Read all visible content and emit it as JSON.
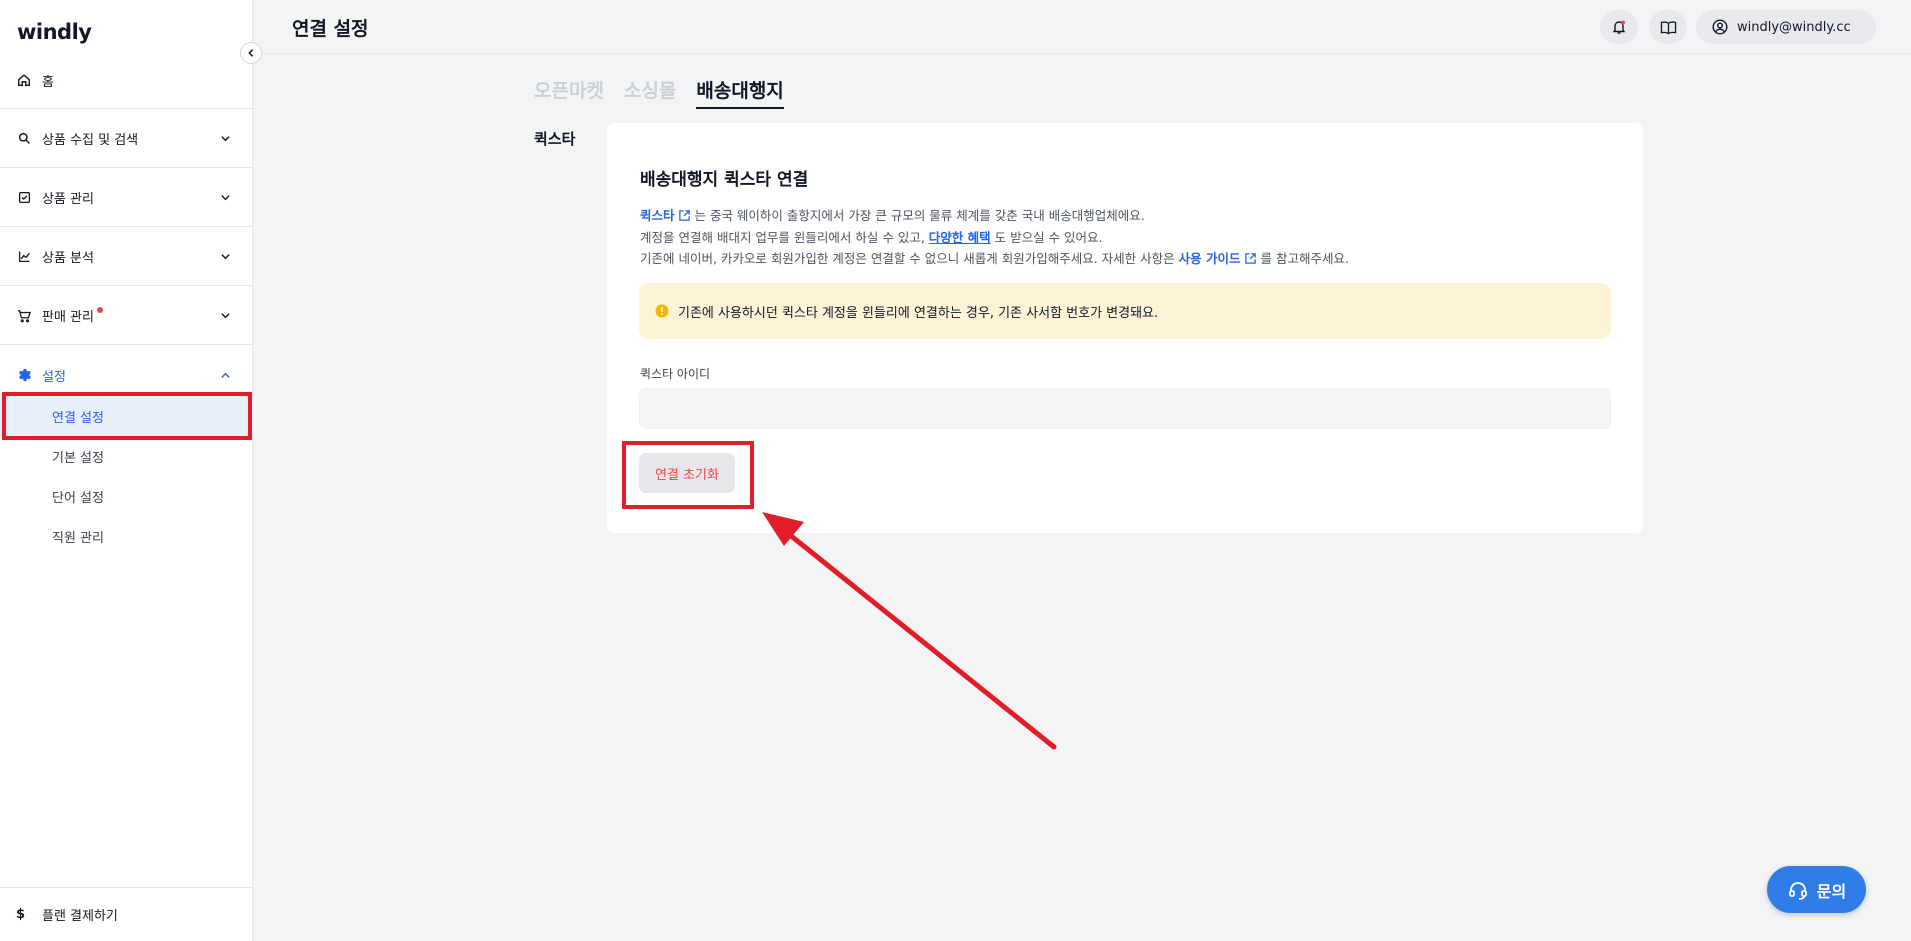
{
  "app": {
    "logo": "windly"
  },
  "header": {
    "title": "연결 설정",
    "user_email": "windly@windly.cc"
  },
  "sidebar": {
    "home": "홈",
    "items": [
      {
        "label": "상품 수집 및 검색"
      },
      {
        "label": "상품 관리"
      },
      {
        "label": "상품 분석"
      },
      {
        "label": "판매 관리"
      },
      {
        "label": "설정"
      }
    ],
    "sub_items": [
      {
        "label": "연결 설정"
      },
      {
        "label": "기본 설정"
      },
      {
        "label": "단어 설정"
      },
      {
        "label": "직원 관리"
      }
    ],
    "footer": "플랜 결제하기",
    "footer_icon": "$"
  },
  "tabs": [
    {
      "label": "오픈마켓"
    },
    {
      "label": "소싱몰"
    },
    {
      "label": "배송대행지"
    }
  ],
  "section": {
    "label": "퀵스타",
    "card_title": "배송대행지 퀵스타 연결",
    "line1_link": "퀵스타",
    "line1_text": " 는 중국 웨이하이 출항지에서 가장 큰 규모의 물류 체계를 갖춘 국내 배송대행업체에요.",
    "line2_text_a": "계정을 연결해 배대지 업무를 윈들리에서 하실 수 있고, ",
    "line2_link": "다양한 혜택",
    "line2_text_b": " 도 받으실 수 있어요.",
    "line3_text_a": "기존에 네이버, 카카오로 회원가입한 계정은 연결할 수 없으니 새롭게 회원가입해주세요. 자세한 사항은 ",
    "line3_link": "사용 가이드",
    "line3_text_b": " 를 참고해주세요.",
    "notice": "기존에 사용하시던 퀵스타 계정을 윈들리에 연결하는 경우, 기존 사서함 번호가 변경돼요.",
    "field_label": "퀵스타 아이디",
    "field_value": "",
    "reset_button": "연결 초기화"
  },
  "help": {
    "label": "문의"
  },
  "colors": {
    "accent": "#2563eb",
    "annotation": "#e11d2a",
    "notice_bg": "#fef3d7",
    "danger": "#ef4444"
  }
}
